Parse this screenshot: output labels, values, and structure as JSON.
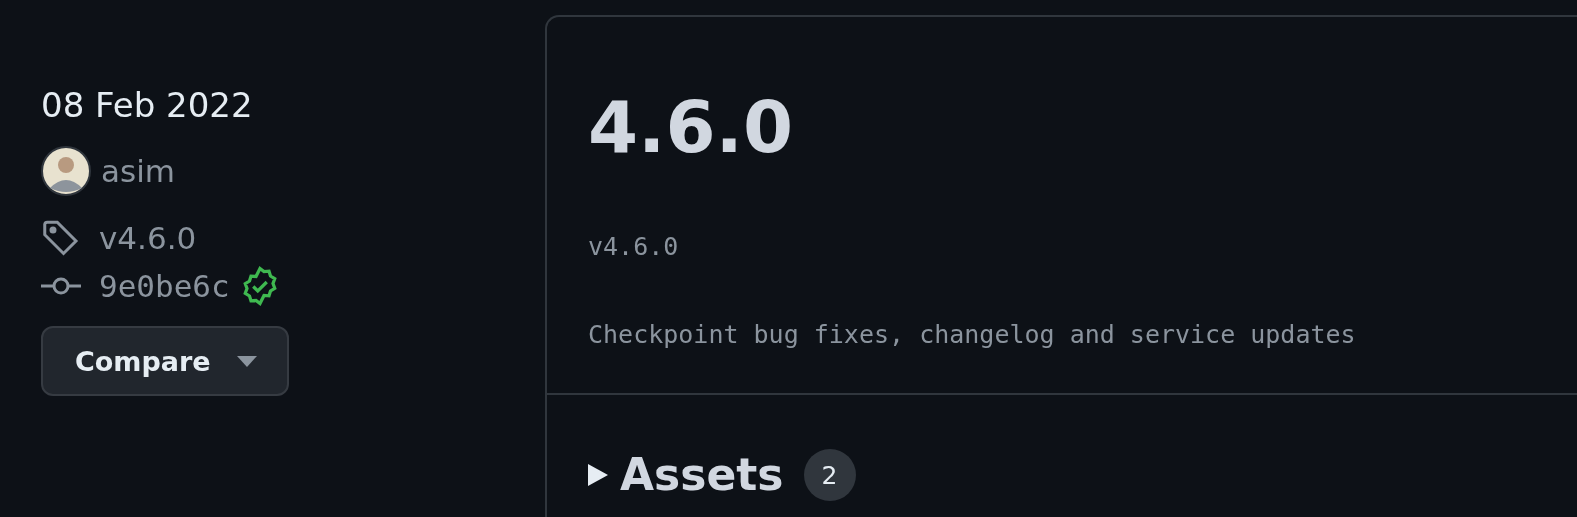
{
  "sidebar": {
    "date": "08 Feb 2022",
    "author": "asim",
    "tag": "v4.6.0",
    "commit": {
      "sha": "9e0be6c",
      "verified": true
    },
    "compare_button": "Compare"
  },
  "release": {
    "title": "4.6.0",
    "body": [
      "v4.6.0",
      "Checkpoint bug fixes, changelog and service updates"
    ],
    "assets": {
      "label": "Assets",
      "count": "2",
      "expanded": false
    }
  }
}
